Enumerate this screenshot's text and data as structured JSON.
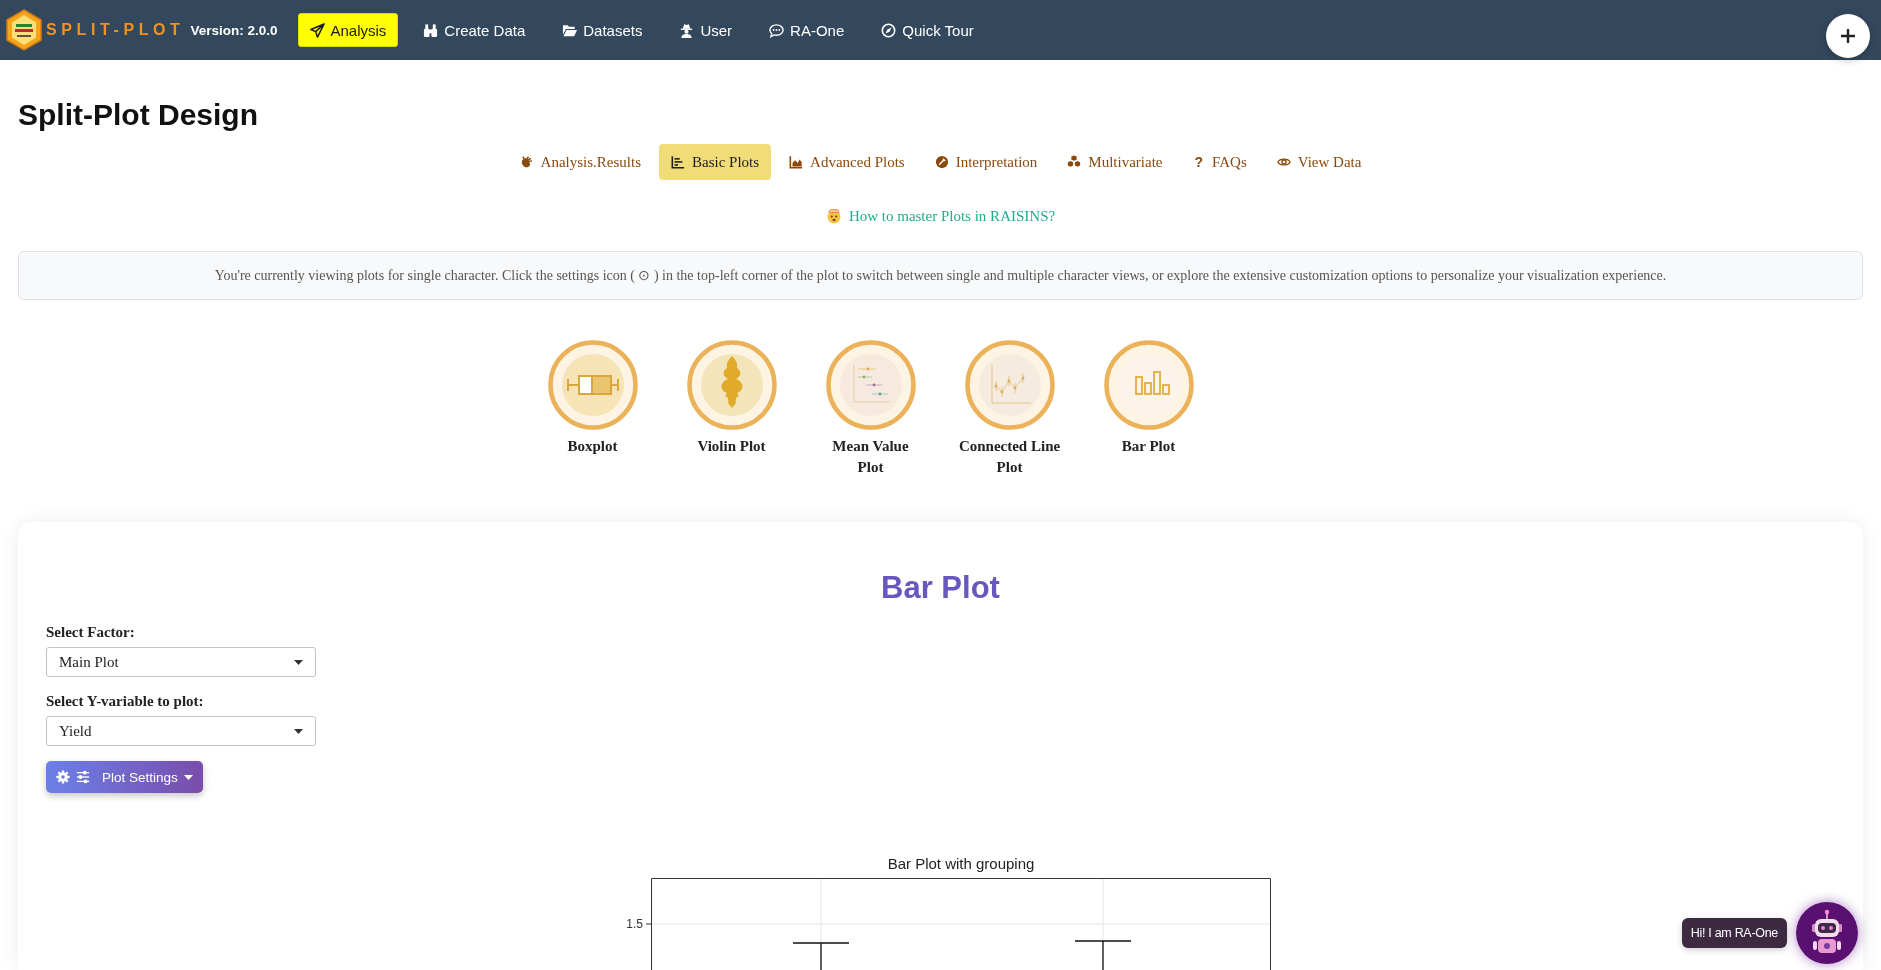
{
  "nav": {
    "brand": "SPLIT-PLOT",
    "version": "Version: 2.0.0",
    "items": [
      {
        "label": "Analysis",
        "selected": true
      },
      {
        "label": "Create Data",
        "selected": false
      },
      {
        "label": "Datasets",
        "selected": false
      },
      {
        "label": "User",
        "selected": false
      },
      {
        "label": "RA-One",
        "selected": false
      },
      {
        "label": "Quick Tour",
        "selected": false
      }
    ]
  },
  "page_title": "Split-Plot Design",
  "tabs": [
    {
      "label": "Analysis.Results",
      "selected": false
    },
    {
      "label": "Basic Plots",
      "selected": true
    },
    {
      "label": "Advanced Plots",
      "selected": false
    },
    {
      "label": "Interpretation",
      "selected": false
    },
    {
      "label": "Multivariate",
      "selected": false
    },
    {
      "label": "FAQs",
      "selected": false,
      "glyph": "?"
    },
    {
      "label": "View Data",
      "selected": false
    }
  ],
  "help_link": "How to master Plots in RAISINS?",
  "info": "You're currently viewing plots for single character. Click the settings icon ( ⊙ ) in the top-left corner of the plot to switch between single and multiple character views, or explore the extensive customization options to personalize your visualization experience.",
  "plot_types": [
    {
      "label": "Boxplot"
    },
    {
      "label": "Violin Plot"
    },
    {
      "label": "Mean Value Plot"
    },
    {
      "label": "Connected Line Plot"
    },
    {
      "label": "Bar Plot"
    }
  ],
  "panel": {
    "title": "Bar Plot",
    "fields": [
      {
        "label": "Select Factor:",
        "value": "Main Plot"
      },
      {
        "label": "Select Y-variable to plot:",
        "value": "Yield"
      }
    ],
    "settings_button": "Plot Settings",
    "chart": {
      "title": "Bar Plot with grouping",
      "y_tick_labels": [
        "1.5"
      ]
    }
  },
  "chat": {
    "greeting": "Hi! I am RA-One"
  }
}
